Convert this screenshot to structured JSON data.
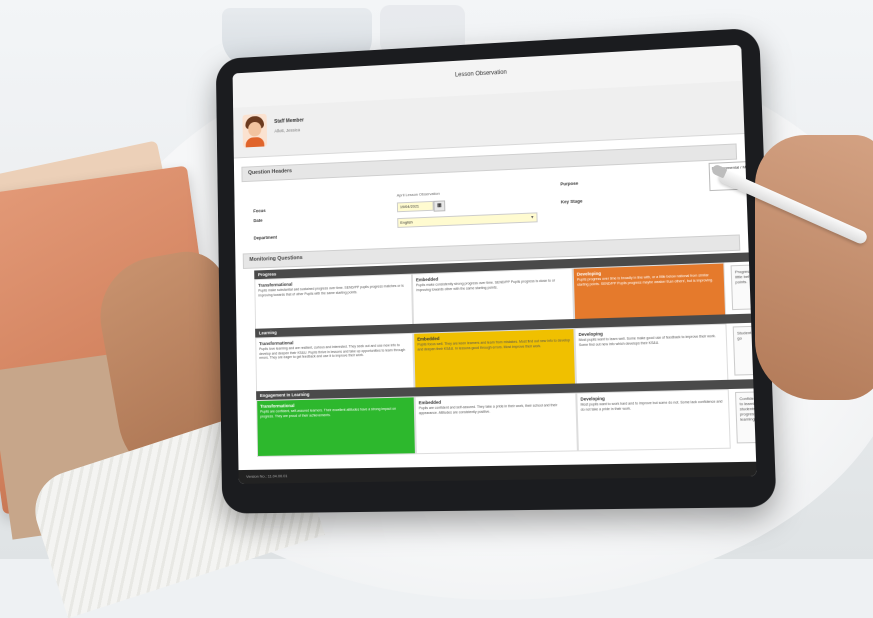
{
  "app": {
    "title": "Lesson Observation"
  },
  "profile": {
    "staff_label": "Staff Member",
    "staff_name": "Allott, Jessica"
  },
  "question_headers": {
    "section_title": "Question Headers",
    "focus_label": "Focus",
    "focus_value": "April Lesson Observation",
    "date_label": "Date",
    "date_value": "19/04/2021",
    "department_label": "Department",
    "department_value": "English",
    "purpose_label": "Purpose",
    "purpose_value": "Developmental / Mid",
    "key_stage_label": "Key Stage"
  },
  "monitoring": {
    "section_title": "Monitoring Questions",
    "groups": [
      {
        "title": "Progress",
        "cells": [
          {
            "title": "Transformational",
            "text": "Pupils make substantial and sustained progress over time. SEND/PP pupils progress matches or is improving towards that of other Pupils with the same starting points.",
            "style": "plain"
          },
          {
            "title": "Embedded",
            "text": "Pupils make consistently strong progress over time. SEND/PP Pupils progress is close to or improving towards other with the same starting points.",
            "style": "plain"
          },
          {
            "title": "Developing",
            "text": "Pupils progress over time is broadly in line with, or a little below national from similar starting points. SEND/PP Pupils progress maybe weaker than others', but is improving.",
            "style": "orange"
          }
        ],
        "comment": "Progress was a little behind points."
      },
      {
        "title": "Learning",
        "cells": [
          {
            "title": "Transformational",
            "text": "Pupils love learning and are resilient, curious and interested. They seek out and use new info to develop and deepen their KS&U. Pupils thrive in lessons and take up opportunities to learn through errors. They are eager to get feedback and use it to improve their work.",
            "style": "plain"
          },
          {
            "title": "Embedded",
            "text": "Pupils focus well. They are keen learners and learn from mistakes. Most find out new info to develop and deepen their KS&U. In lessons good through errors. Most improve their work.",
            "style": "yellow"
          },
          {
            "title": "Developing",
            "text": "Most pupils want to learn well. Some make good use of feedback to improve their work. Some find out new info which develops their KS&U.",
            "style": "plain"
          }
        ],
        "comment": "Students making go"
      },
      {
        "title": "Engagement in Learning",
        "cells": [
          {
            "title": "Transformational",
            "text": "Pupils are confident, self-assured learners. Their excellent attitudes have a strong impact on progress. They are proud of their achievements.",
            "style": "green"
          },
          {
            "title": "Embedded",
            "text": "Pupils are confident and self-assured. They take a pride in their work, their school and their appearance. Attitudes are consistently positive.",
            "style": "plain"
          },
          {
            "title": "Developing",
            "text": "Most pupils want to work hard and to improve but some do not. Some lack confidence and do not take a pride in their work.",
            "style": "plain"
          }
        ],
        "comment": "Confident attitude to learning the students are progress that learning is lea"
      }
    ]
  },
  "footer": {
    "version": "Version No.: 11.04.00.01"
  }
}
